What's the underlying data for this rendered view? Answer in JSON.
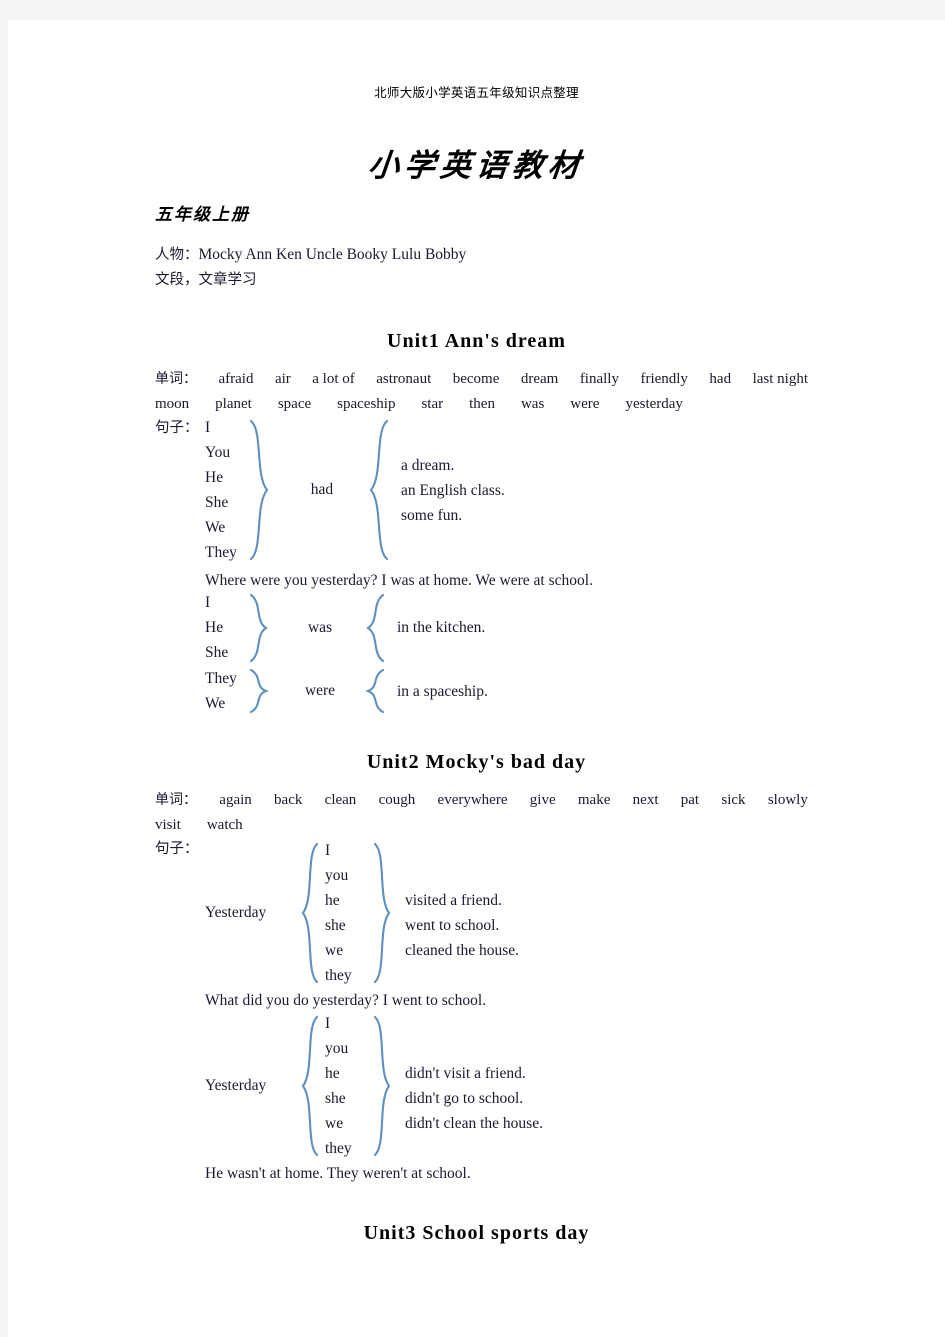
{
  "header": {
    "running_head": "北师大版小学英语五年级知识点整理",
    "title": "小学英语教材"
  },
  "volume": {
    "heading": "五年级上册",
    "characters_label": "人物：",
    "characters": "Mocky    Ann    Ken    Uncle Booky    Lulu    Bobby",
    "study_line": "文段，文章学习"
  },
  "units": [
    {
      "heading": "Unit1  Ann's dream",
      "vocab_label": "单词：",
      "vocab_row1": [
        "afraid",
        "air",
        "a lot of",
        "astronaut",
        "become",
        "dream",
        "finally",
        "friendly",
        "had",
        "last night"
      ],
      "vocab_row2": [
        "moon",
        "planet",
        "space",
        "spaceship",
        "star",
        "then",
        "was",
        "were",
        "yesterday"
      ],
      "sentence_label": "句子：",
      "group1": {
        "pronouns": [
          "I",
          "You",
          "He",
          "She",
          "We",
          "They"
        ],
        "verb": "had",
        "predicates": [
          "a dream.",
          "an English class.",
          "some fun."
        ]
      },
      "example_line": "Where were you yesterday?    I was at home.    We were at school.",
      "group2": {
        "pronouns": [
          "I",
          "He",
          "She"
        ],
        "verb": "was",
        "predicates": [
          "in the kitchen."
        ]
      },
      "group3": {
        "pronouns": [
          "They",
          "We"
        ],
        "verb": "were",
        "predicates": [
          "in a spaceship."
        ]
      }
    },
    {
      "heading": "Unit2  Mocky's bad day",
      "vocab_label": "单词：",
      "vocab_row1": [
        "again",
        "back",
        "clean",
        "cough",
        "everywhere",
        "give",
        "make",
        "next",
        "pat",
        "sick",
        "slowly"
      ],
      "vocab_row2": [
        "visit",
        "watch"
      ],
      "sentence_label": "句子：",
      "group1": {
        "lead": "Yesterday",
        "pronouns": [
          "I",
          "you",
          "he",
          "she",
          "we",
          "they"
        ],
        "predicates": [
          "visited a friend.",
          "went to school.",
          "cleaned the house."
        ]
      },
      "example_line": "What did you do yesterday?    I went to school.",
      "group2": {
        "lead": "Yesterday",
        "pronouns": [
          "I",
          "you",
          "he",
          "she",
          "we",
          "they"
        ],
        "predicates": [
          "didn't visit a friend.",
          "didn't go to school.",
          "didn't clean the house."
        ]
      },
      "closing_line": "He wasn't at home.    They weren't at school."
    },
    {
      "heading": "Unit3  School sports day"
    }
  ],
  "colors": {
    "brace": "#5f8fbd",
    "text": "#1a1a2e",
    "page": "#ffffff",
    "margin": "#f4f4f4"
  }
}
